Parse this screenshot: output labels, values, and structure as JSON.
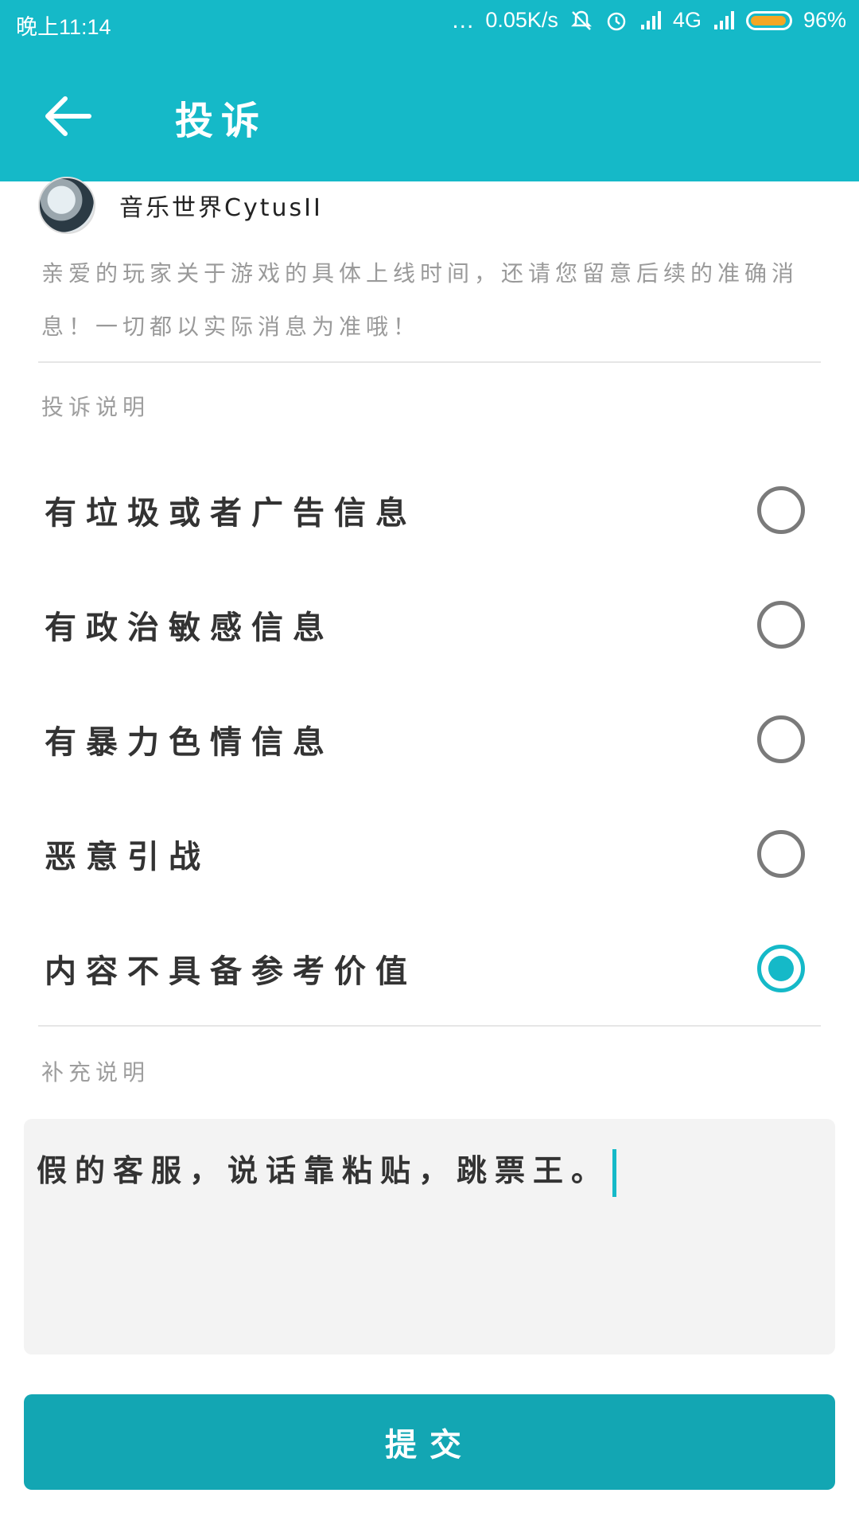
{
  "status_bar": {
    "time": "晚上11:14",
    "dots": "...",
    "network_speed": "0.05K/s",
    "network_type": "4G",
    "battery_percent": "96%",
    "icons": [
      "mute-icon",
      "alarm-icon",
      "signal-icon",
      "signal-icon"
    ]
  },
  "app_bar": {
    "title": "投诉",
    "back_icon": "arrow-left-icon"
  },
  "post": {
    "username": "音乐世界CytusII",
    "notice": "亲爱的玩家关于游戏的具体上线时间，还请您留意后续的准确消息！一切都以实际消息为准哦！"
  },
  "complaint_section": {
    "label": "投诉说明",
    "options": [
      {
        "label": "有垃圾或者广告信息",
        "selected": false
      },
      {
        "label": "有政治敏感信息",
        "selected": false
      },
      {
        "label": "有暴力色情信息",
        "selected": false
      },
      {
        "label": "恶意引战",
        "selected": false
      },
      {
        "label": "内容不具备参考价值",
        "selected": true
      }
    ]
  },
  "supplement_section": {
    "label": "补充说明",
    "input_value": "假的客服，说话靠粘贴，跳票王。"
  },
  "submit": {
    "label": "提交"
  },
  "colors": {
    "accent": "#15b9c8",
    "button": "#13a6b3",
    "battery": "#f5a623"
  }
}
